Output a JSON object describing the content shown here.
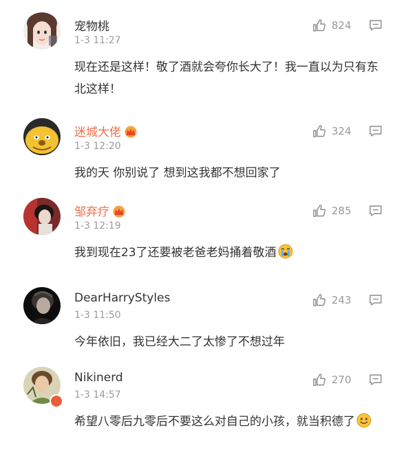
{
  "comments": [
    {
      "name": "宠物桃",
      "time": "1-3 11:27",
      "likes": "824",
      "text": "现在还是这样！敬了酒就会夸你长大了！我一直以为只有东北这样！",
      "vip": false
    },
    {
      "name": "迷城大佬",
      "time": "1-3 12:20",
      "likes": "324",
      "text": "我的天 你别说了 想到这我都不想回家了",
      "vip": true
    },
    {
      "name": "邹弃疗",
      "time": "1-3 12:19",
      "likes": "285",
      "text": "我到现在23了还要被老爸老妈捅着敬酒",
      "vip": true
    },
    {
      "name": "DearHarryStyles",
      "time": "1-3 11:50",
      "likes": "243",
      "text": "今年依旧，我已经大二了太惨了不想过年",
      "vip": false
    },
    {
      "name": "Nikinerd",
      "time": "1-3 14:57",
      "likes": "270",
      "text": "希望八零后九零后不要这么对自己的小孩，就当积德了",
      "vip": false
    }
  ],
  "icons": {
    "like": "thumbs-up-icon",
    "reply": "comment-icon",
    "crown": "vip-crown-icon",
    "crying": "crying-face-emoji",
    "smile": "smiling-face-emoji"
  },
  "colors": {
    "vip_name": "#eb7350",
    "meta": "#9b9b9b",
    "text": "#333333"
  }
}
